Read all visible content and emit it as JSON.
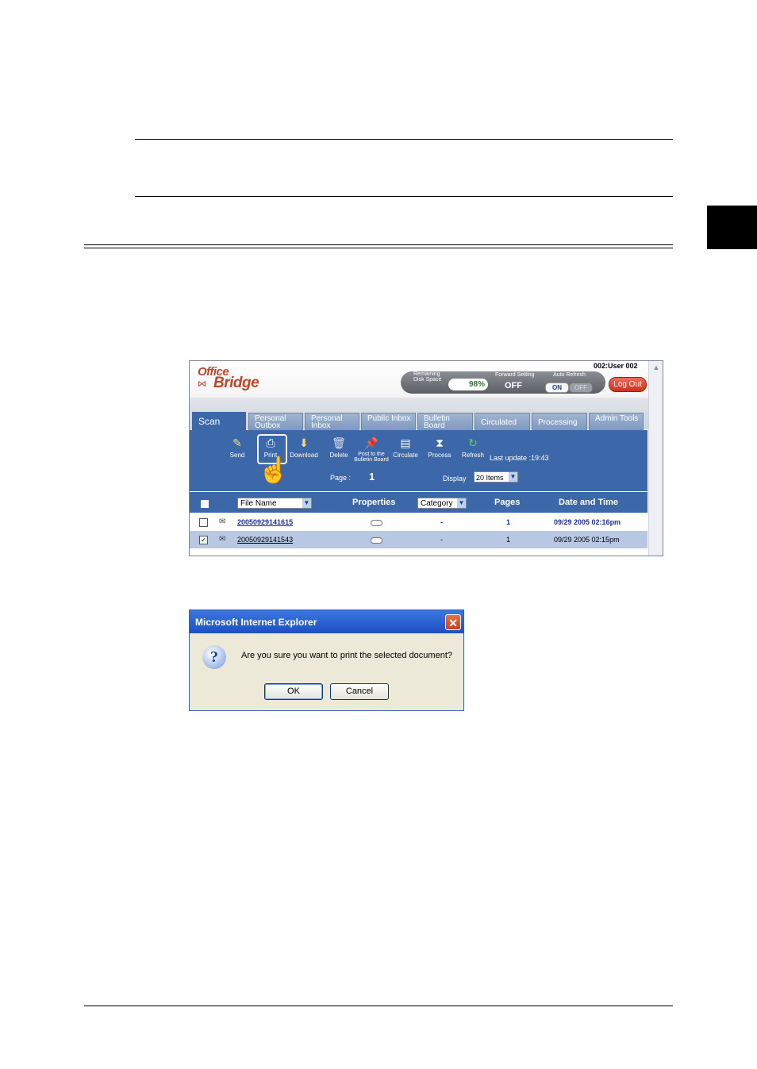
{
  "document": {
    "chapter_tab_color": "#000000"
  },
  "app": {
    "logo_top": "Office",
    "logo_bottom": "Bridge",
    "user": "002:User 002",
    "status": {
      "remaining_label": "Remaining Disk Space",
      "remaining_value": "98%",
      "forward_label": "Forward Setting",
      "forward_value": "OFF",
      "auto_refresh_label": "Auto Refresh",
      "auto_on": "ON",
      "auto_off": "OFF"
    },
    "logout_label": "Log Out",
    "tabs": [
      {
        "label": "Scan"
      },
      {
        "label": "Personal Outbox"
      },
      {
        "label": "Personal Inbox"
      },
      {
        "label": "Public Inbox"
      },
      {
        "label": "Bulletin Board"
      },
      {
        "label": "Circulated"
      },
      {
        "label": "Processing"
      },
      {
        "label": "Admin Tools"
      }
    ],
    "toolbar": [
      {
        "label": "Send",
        "icon": "send-icon"
      },
      {
        "label": "Print",
        "icon": "print-icon"
      },
      {
        "label": "Download",
        "icon": "download-icon"
      },
      {
        "label": "Delete",
        "icon": "trash-icon"
      },
      {
        "label": "Post to the Bulletin Board",
        "icon": "pin-icon"
      },
      {
        "label": "Circulate",
        "icon": "circulate-icon"
      },
      {
        "label": "Process",
        "icon": "hourglass-icon"
      },
      {
        "label": "Refresh",
        "icon": "refresh-icon"
      }
    ],
    "last_update": "Last update :19:43",
    "page_label": "Page :",
    "page_value": "1",
    "display_label": "Display",
    "display_value": "20 Items",
    "columns": {
      "file_name": "File Name",
      "properties": "Properties",
      "category": "Category",
      "pages": "Pages",
      "date_time": "Date and Time"
    },
    "rows": [
      {
        "file": "20050929141615",
        "category": "-",
        "pages": "1",
        "date": "09/29 2005 02:16pm",
        "checked": false
      },
      {
        "file": "20050929141543",
        "category": "-",
        "pages": "1",
        "date": "09/29 2005 02:15pm",
        "checked": true
      }
    ]
  },
  "dialog": {
    "title": "Microsoft Internet Explorer",
    "message": "Are you sure you want to print the selected document?",
    "ok_label": "OK",
    "cancel_label": "Cancel"
  }
}
